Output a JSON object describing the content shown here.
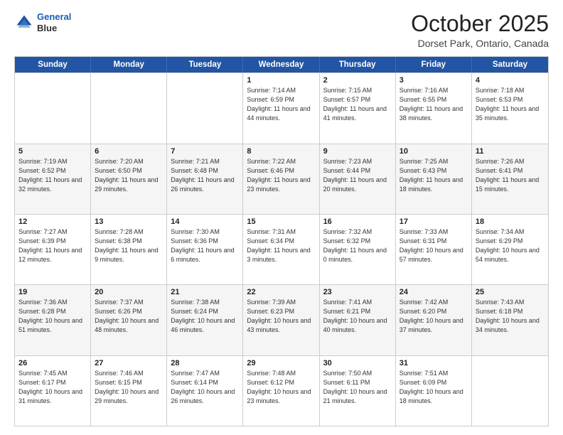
{
  "header": {
    "logo_line1": "General",
    "logo_line2": "Blue",
    "month_title": "October 2025",
    "location": "Dorset Park, Ontario, Canada"
  },
  "weekdays": [
    "Sunday",
    "Monday",
    "Tuesday",
    "Wednesday",
    "Thursday",
    "Friday",
    "Saturday"
  ],
  "weeks": [
    [
      {
        "day": "",
        "info": ""
      },
      {
        "day": "",
        "info": ""
      },
      {
        "day": "",
        "info": ""
      },
      {
        "day": "1",
        "info": "Sunrise: 7:14 AM\nSunset: 6:59 PM\nDaylight: 11 hours\nand 44 minutes."
      },
      {
        "day": "2",
        "info": "Sunrise: 7:15 AM\nSunset: 6:57 PM\nDaylight: 11 hours\nand 41 minutes."
      },
      {
        "day": "3",
        "info": "Sunrise: 7:16 AM\nSunset: 6:55 PM\nDaylight: 11 hours\nand 38 minutes."
      },
      {
        "day": "4",
        "info": "Sunrise: 7:18 AM\nSunset: 6:53 PM\nDaylight: 11 hours\nand 35 minutes."
      }
    ],
    [
      {
        "day": "5",
        "info": "Sunrise: 7:19 AM\nSunset: 6:52 PM\nDaylight: 11 hours\nand 32 minutes."
      },
      {
        "day": "6",
        "info": "Sunrise: 7:20 AM\nSunset: 6:50 PM\nDaylight: 11 hours\nand 29 minutes."
      },
      {
        "day": "7",
        "info": "Sunrise: 7:21 AM\nSunset: 6:48 PM\nDaylight: 11 hours\nand 26 minutes."
      },
      {
        "day": "8",
        "info": "Sunrise: 7:22 AM\nSunset: 6:46 PM\nDaylight: 11 hours\nand 23 minutes."
      },
      {
        "day": "9",
        "info": "Sunrise: 7:23 AM\nSunset: 6:44 PM\nDaylight: 11 hours\nand 20 minutes."
      },
      {
        "day": "10",
        "info": "Sunrise: 7:25 AM\nSunset: 6:43 PM\nDaylight: 11 hours\nand 18 minutes."
      },
      {
        "day": "11",
        "info": "Sunrise: 7:26 AM\nSunset: 6:41 PM\nDaylight: 11 hours\nand 15 minutes."
      }
    ],
    [
      {
        "day": "12",
        "info": "Sunrise: 7:27 AM\nSunset: 6:39 PM\nDaylight: 11 hours\nand 12 minutes."
      },
      {
        "day": "13",
        "info": "Sunrise: 7:28 AM\nSunset: 6:38 PM\nDaylight: 11 hours\nand 9 minutes."
      },
      {
        "day": "14",
        "info": "Sunrise: 7:30 AM\nSunset: 6:36 PM\nDaylight: 11 hours\nand 6 minutes."
      },
      {
        "day": "15",
        "info": "Sunrise: 7:31 AM\nSunset: 6:34 PM\nDaylight: 11 hours\nand 3 minutes."
      },
      {
        "day": "16",
        "info": "Sunrise: 7:32 AM\nSunset: 6:32 PM\nDaylight: 11 hours\nand 0 minutes."
      },
      {
        "day": "17",
        "info": "Sunrise: 7:33 AM\nSunset: 6:31 PM\nDaylight: 10 hours\nand 57 minutes."
      },
      {
        "day": "18",
        "info": "Sunrise: 7:34 AM\nSunset: 6:29 PM\nDaylight: 10 hours\nand 54 minutes."
      }
    ],
    [
      {
        "day": "19",
        "info": "Sunrise: 7:36 AM\nSunset: 6:28 PM\nDaylight: 10 hours\nand 51 minutes."
      },
      {
        "day": "20",
        "info": "Sunrise: 7:37 AM\nSunset: 6:26 PM\nDaylight: 10 hours\nand 48 minutes."
      },
      {
        "day": "21",
        "info": "Sunrise: 7:38 AM\nSunset: 6:24 PM\nDaylight: 10 hours\nand 46 minutes."
      },
      {
        "day": "22",
        "info": "Sunrise: 7:39 AM\nSunset: 6:23 PM\nDaylight: 10 hours\nand 43 minutes."
      },
      {
        "day": "23",
        "info": "Sunrise: 7:41 AM\nSunset: 6:21 PM\nDaylight: 10 hours\nand 40 minutes."
      },
      {
        "day": "24",
        "info": "Sunrise: 7:42 AM\nSunset: 6:20 PM\nDaylight: 10 hours\nand 37 minutes."
      },
      {
        "day": "25",
        "info": "Sunrise: 7:43 AM\nSunset: 6:18 PM\nDaylight: 10 hours\nand 34 minutes."
      }
    ],
    [
      {
        "day": "26",
        "info": "Sunrise: 7:45 AM\nSunset: 6:17 PM\nDaylight: 10 hours\nand 31 minutes."
      },
      {
        "day": "27",
        "info": "Sunrise: 7:46 AM\nSunset: 6:15 PM\nDaylight: 10 hours\nand 29 minutes."
      },
      {
        "day": "28",
        "info": "Sunrise: 7:47 AM\nSunset: 6:14 PM\nDaylight: 10 hours\nand 26 minutes."
      },
      {
        "day": "29",
        "info": "Sunrise: 7:48 AM\nSunset: 6:12 PM\nDaylight: 10 hours\nand 23 minutes."
      },
      {
        "day": "30",
        "info": "Sunrise: 7:50 AM\nSunset: 6:11 PM\nDaylight: 10 hours\nand 21 minutes."
      },
      {
        "day": "31",
        "info": "Sunrise: 7:51 AM\nSunset: 6:09 PM\nDaylight: 10 hours\nand 18 minutes."
      },
      {
        "day": "",
        "info": ""
      }
    ]
  ]
}
